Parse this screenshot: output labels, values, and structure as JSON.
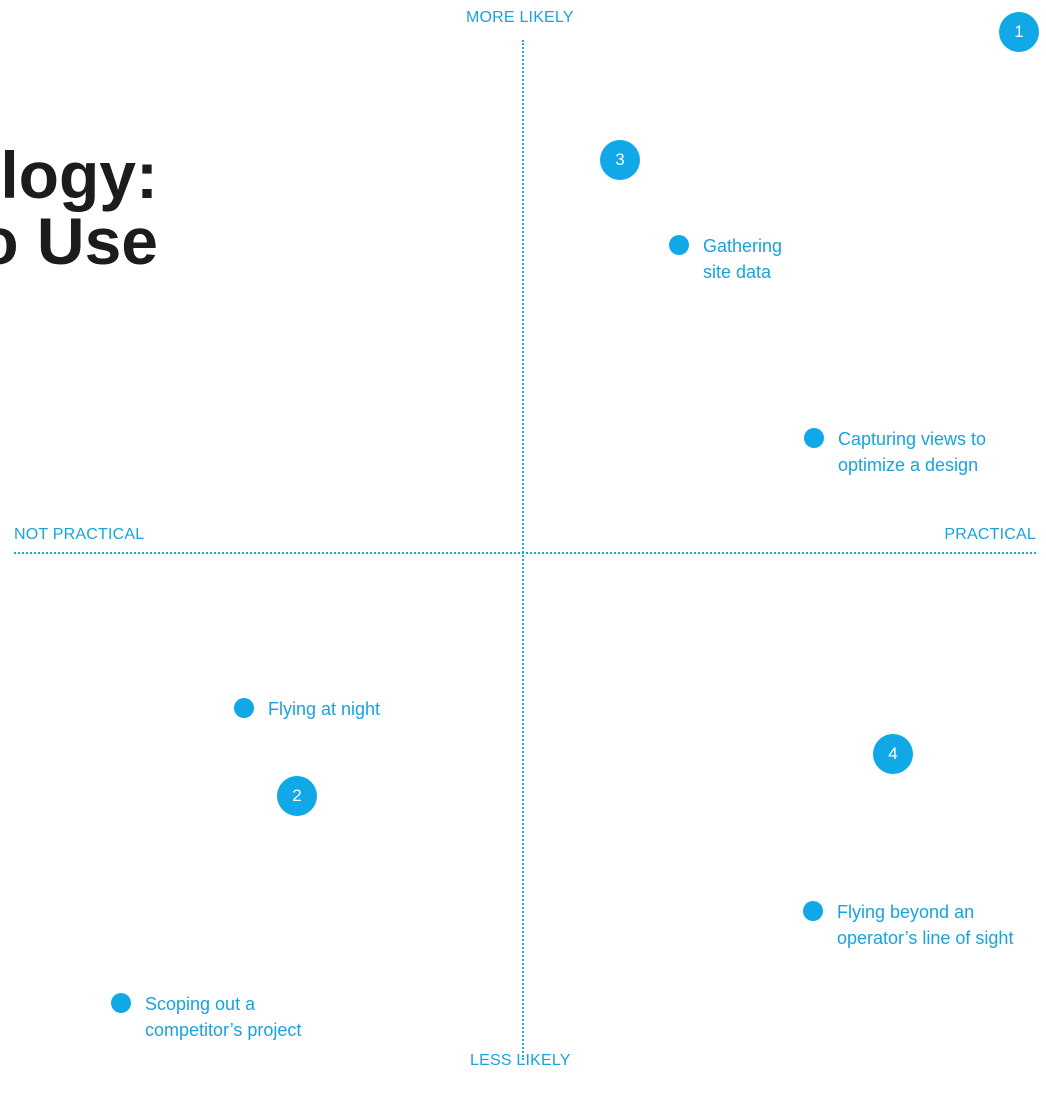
{
  "title": {
    "line1": "logy:",
    "line2": "o Use"
  },
  "axes": {
    "top": "MORE LIKELY",
    "bottom": "LESS LIKELY",
    "left": "NOT PRACTICAL",
    "right": "PRACTICAL"
  },
  "badges": {
    "one": "1",
    "two": "2",
    "three": "3",
    "four": "4"
  },
  "items": {
    "gathering": {
      "line1": "Gathering",
      "line2": "site data"
    },
    "capturing": {
      "line1": "Capturing views to",
      "line2": "optimize a design"
    },
    "night": {
      "line1": "Flying at night"
    },
    "beyond": {
      "line1": "Flying beyond an",
      "line2": "operator’s line of sight"
    },
    "scoping": {
      "line1": "Scoping out a",
      "line2": "competitor’s project"
    }
  },
  "colors": {
    "accent": "#10a8e6",
    "label": "#18a3de",
    "title": "#1c1c1c"
  }
}
